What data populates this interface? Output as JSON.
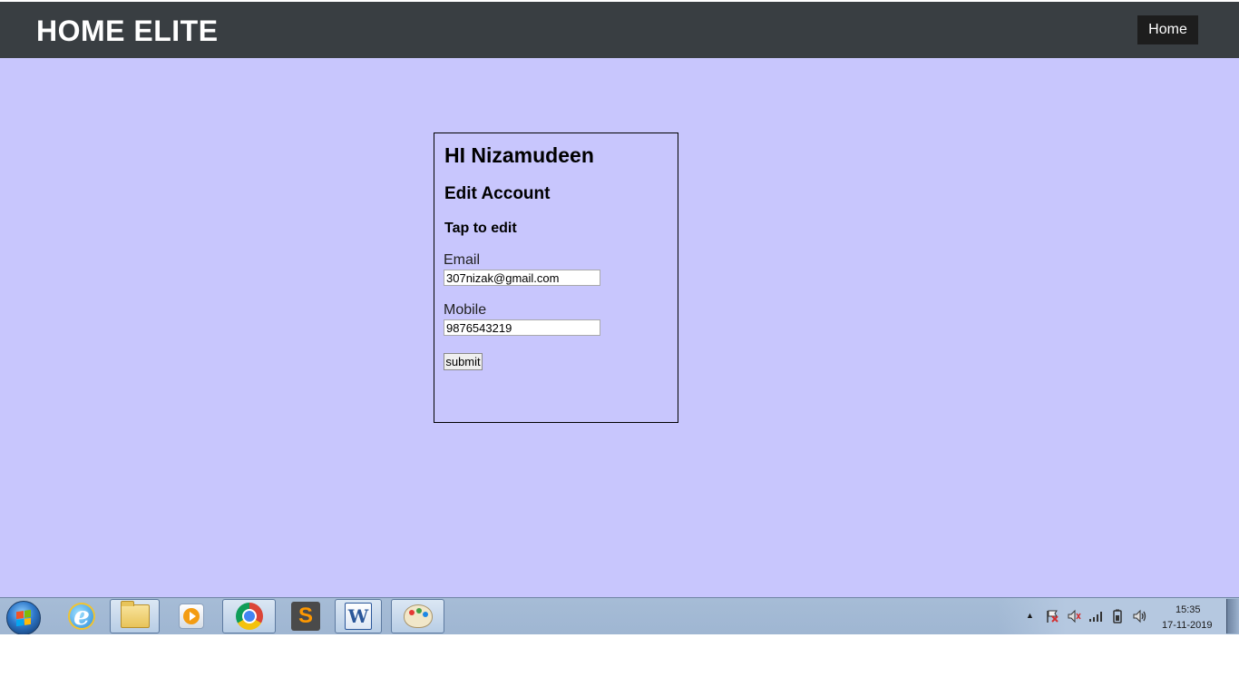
{
  "navbar": {
    "brand": "HOME ELITE",
    "home_link": "Home"
  },
  "card": {
    "greeting": "HI Nizamudeen",
    "title": "Edit Account",
    "subtitle": "Tap to edit",
    "email_label": "Email",
    "email_value": "307nizak@gmail.com",
    "mobile_label": "Mobile",
    "mobile_value": "9876543219",
    "submit_label": "submit"
  },
  "colors": {
    "navbar_bg": "#393e42",
    "page_bg": "#c8c6fd",
    "nav_button_bg": "#1d1d1d"
  },
  "taskbar": {
    "apps": [
      {
        "name": "internet-explorer-icon"
      },
      {
        "name": "file-explorer-icon"
      },
      {
        "name": "media-player-icon"
      },
      {
        "name": "chrome-icon"
      },
      {
        "name": "sublime-text-icon",
        "glyph": "S"
      },
      {
        "name": "word-icon",
        "glyph": "W"
      },
      {
        "name": "paint-icon"
      }
    ],
    "clock": {
      "time": "15:35",
      "date": "17-11-2019"
    }
  }
}
